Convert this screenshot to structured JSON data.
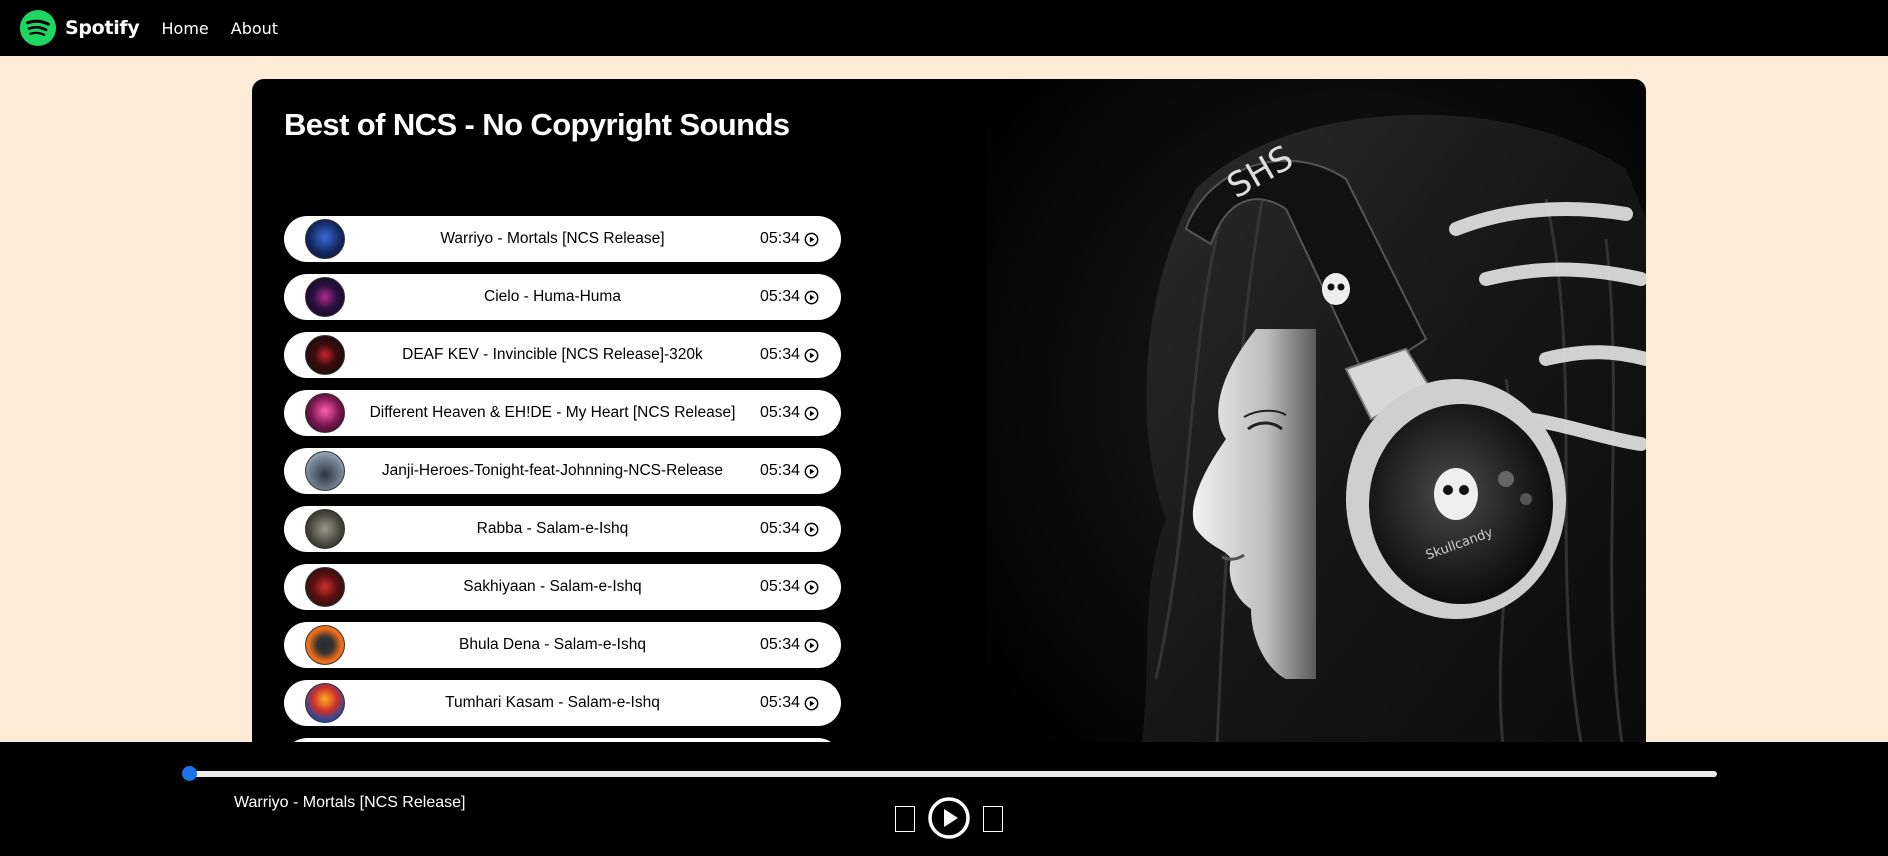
{
  "nav": {
    "brand": "Spotify",
    "links": [
      "Home",
      "About"
    ]
  },
  "main": {
    "title": "Best of NCS - No Copyright Sounds",
    "songs": [
      {
        "name": "Warriyo - Mortals [NCS Release]",
        "time": "05:34"
      },
      {
        "name": "Cielo - Huma-Huma",
        "time": "05:34"
      },
      {
        "name": "DEAF KEV - Invincible [NCS Release]-320k",
        "time": "05:34"
      },
      {
        "name": "Different Heaven & EH!DE - My Heart [NCS Release]",
        "time": "05:34"
      },
      {
        "name": "Janji-Heroes-Tonight-feat-Johnning-NCS-Release",
        "time": "05:34"
      },
      {
        "name": "Rabba - Salam-e-Ishq",
        "time": "05:34"
      },
      {
        "name": "Sakhiyaan - Salam-e-Ishq",
        "time": "05:34"
      },
      {
        "name": "Bhula Dena - Salam-e-Ishq",
        "time": "05:34"
      },
      {
        "name": "Tumhari Kasam - Salam-e-Ishq",
        "time": "05:34"
      }
    ]
  },
  "player": {
    "now_playing": "Warriyo - Mortals [NCS Release]",
    "progress": 0
  },
  "colors": {
    "page_bg": "#fbebd7",
    "bar_bg": "#000000",
    "brand_green": "#1ed760",
    "progress_thumb": "#1a73e8"
  },
  "icons": {
    "brand": "spotify-logo-icon",
    "song_play": "play-circle-icon",
    "prev": "backward-step-icon",
    "play": "play-circle-icon",
    "next": "forward-step-icon"
  }
}
